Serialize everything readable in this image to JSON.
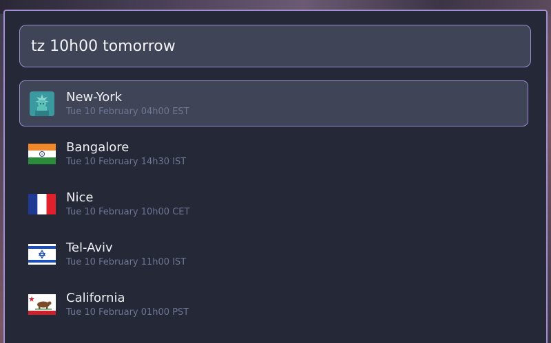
{
  "search": {
    "value": "tz 10h00 tomorrow"
  },
  "results": [
    {
      "city": "New-York",
      "time": "Tue 10 February 04h00 EST",
      "icon": "statue-of-liberty-icon",
      "selected": true
    },
    {
      "city": "Bangalore",
      "time": "Tue 10 February 14h30 IST",
      "icon": "india-flag-icon",
      "selected": false
    },
    {
      "city": "Nice",
      "time": "Tue 10 February 10h00 CET",
      "icon": "france-flag-icon",
      "selected": false
    },
    {
      "city": "Tel-Aviv",
      "time": "Tue 10 February 11h00 IST",
      "icon": "israel-flag-icon",
      "selected": false
    },
    {
      "city": "California",
      "time": "Tue 10 February 01h00 PST",
      "icon": "california-flag-icon",
      "selected": false
    }
  ],
  "colors": {
    "accent": "#9a8fd0",
    "panel": "#252836",
    "selected_bg": "#3f4457"
  }
}
